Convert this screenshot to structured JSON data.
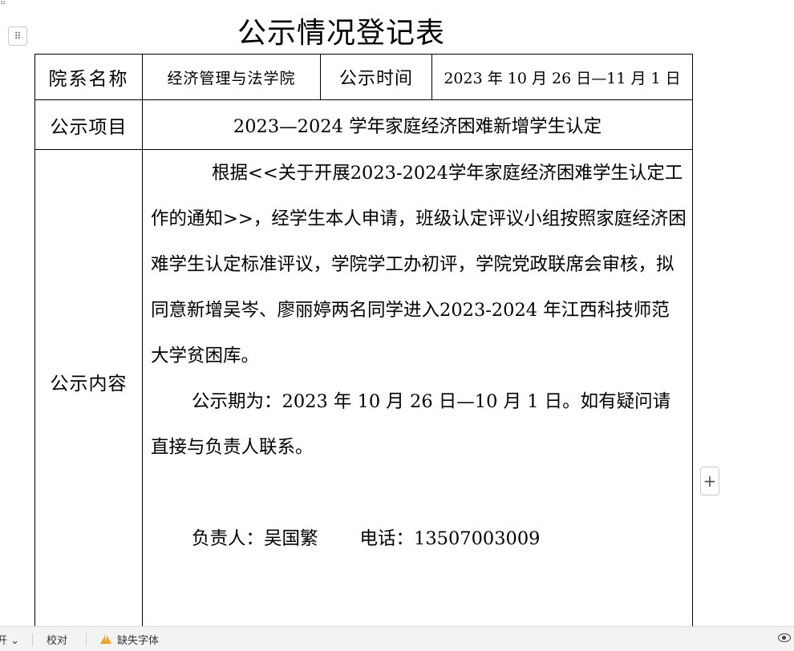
{
  "document": {
    "title": "公示情况登记表"
  },
  "table": {
    "dept_label": "院系名称",
    "dept_value": "经济管理与法学院",
    "time_label": "公示时间",
    "time_value": "2023 年 10 月 26 日—11 月 1 日",
    "item_label": "公示项目",
    "item_value": "2023—2024 学年家庭经济困难新增学生认定",
    "content_label": "公示内容",
    "content_para1": "根据<<关于开展2023-2024学年家庭经济困难学生认定工作的通知>>，经学生本人申请，班级认定评议小组按照家庭经济困难学生认定标准评议，学院学工办初评，学院党政联席会审核，拟同意新增吴岑、廖丽婷两名同学进入2023-2024 年江西科技师范大学贫困库。",
    "content_para2": "公示期为：2023 年 10 月 26 日—10 月 1 日。如有疑问请直接与负责人联系。",
    "contact_person": "负责人：吴国繁",
    "contact_phone": "电话：13507003009"
  },
  "ui": {
    "drag_handle_glyph": "⠿",
    "add_row_glyph": "+",
    "table_handle_glyph": "⠿"
  },
  "statusbar": {
    "left_item": "开 ⌄",
    "proofread": "校对",
    "missing_fonts": "缺失字体",
    "warning_color": "#f0a020"
  }
}
